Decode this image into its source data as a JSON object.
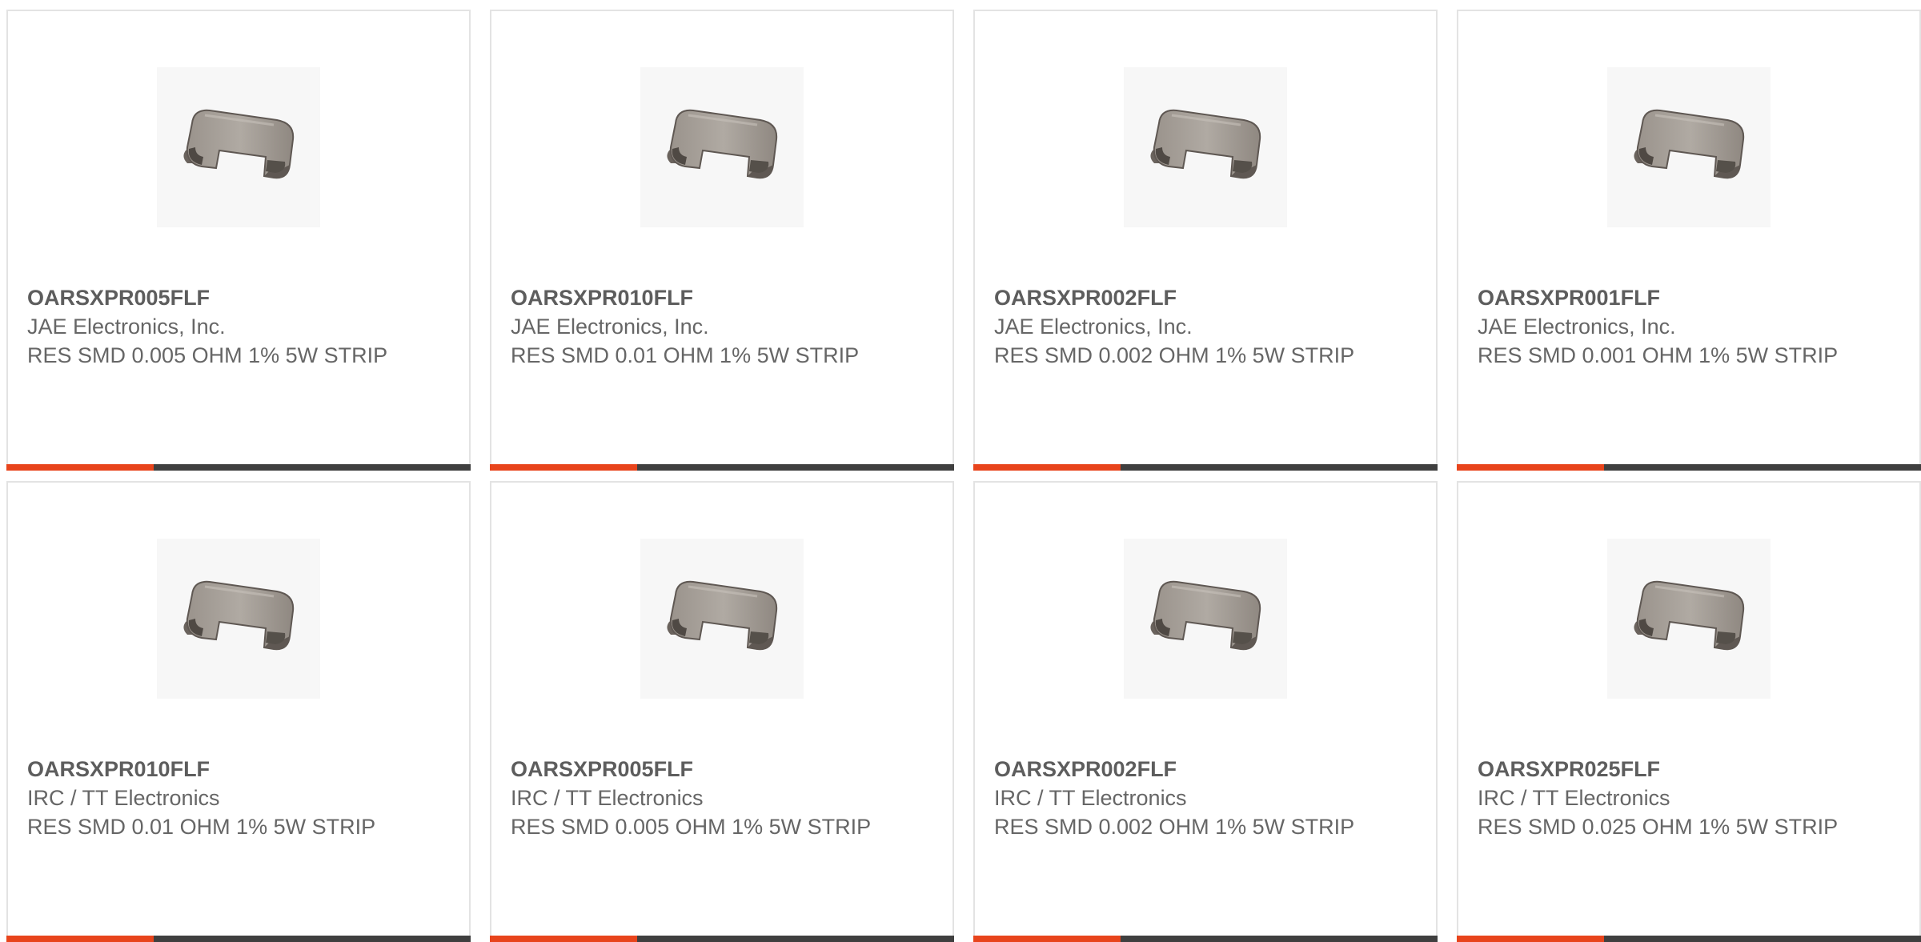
{
  "accent_color": "#e8441c",
  "bar_color": "#3f3f3f",
  "products": [
    {
      "part_number": "OARSXPR005FLF",
      "manufacturer": "JAE Electronics, Inc.",
      "description": "RES SMD 0.005 OHM 1% 5W STRIP",
      "image_icon": "shunt-resistor-strip-icon"
    },
    {
      "part_number": "OARSXPR010FLF",
      "manufacturer": "JAE Electronics, Inc.",
      "description": "RES SMD 0.01 OHM 1% 5W STRIP",
      "image_icon": "shunt-resistor-strip-icon"
    },
    {
      "part_number": "OARSXPR002FLF",
      "manufacturer": "JAE Electronics, Inc.",
      "description": "RES SMD 0.002 OHM 1% 5W STRIP",
      "image_icon": "shunt-resistor-strip-icon"
    },
    {
      "part_number": "OARSXPR001FLF",
      "manufacturer": "JAE Electronics, Inc.",
      "description": "RES SMD 0.001 OHM 1% 5W STRIP",
      "image_icon": "shunt-resistor-strip-icon"
    },
    {
      "part_number": "OARSXPR010FLF",
      "manufacturer": "IRC / TT Electronics",
      "description": "RES SMD 0.01 OHM 1% 5W STRIP",
      "image_icon": "shunt-resistor-strip-icon"
    },
    {
      "part_number": "OARSXPR005FLF",
      "manufacturer": "IRC / TT Electronics",
      "description": "RES SMD 0.005 OHM 1% 5W STRIP",
      "image_icon": "shunt-resistor-strip-icon"
    },
    {
      "part_number": "OARSXPR002FLF",
      "manufacturer": "IRC / TT Electronics",
      "description": "RES SMD 0.002 OHM 1% 5W STRIP",
      "image_icon": "shunt-resistor-strip-icon"
    },
    {
      "part_number": "OARSXPR025FLF",
      "manufacturer": "IRC / TT Electronics",
      "description": "RES SMD 0.025 OHM 1% 5W STRIP",
      "image_icon": "shunt-resistor-strip-icon"
    }
  ]
}
